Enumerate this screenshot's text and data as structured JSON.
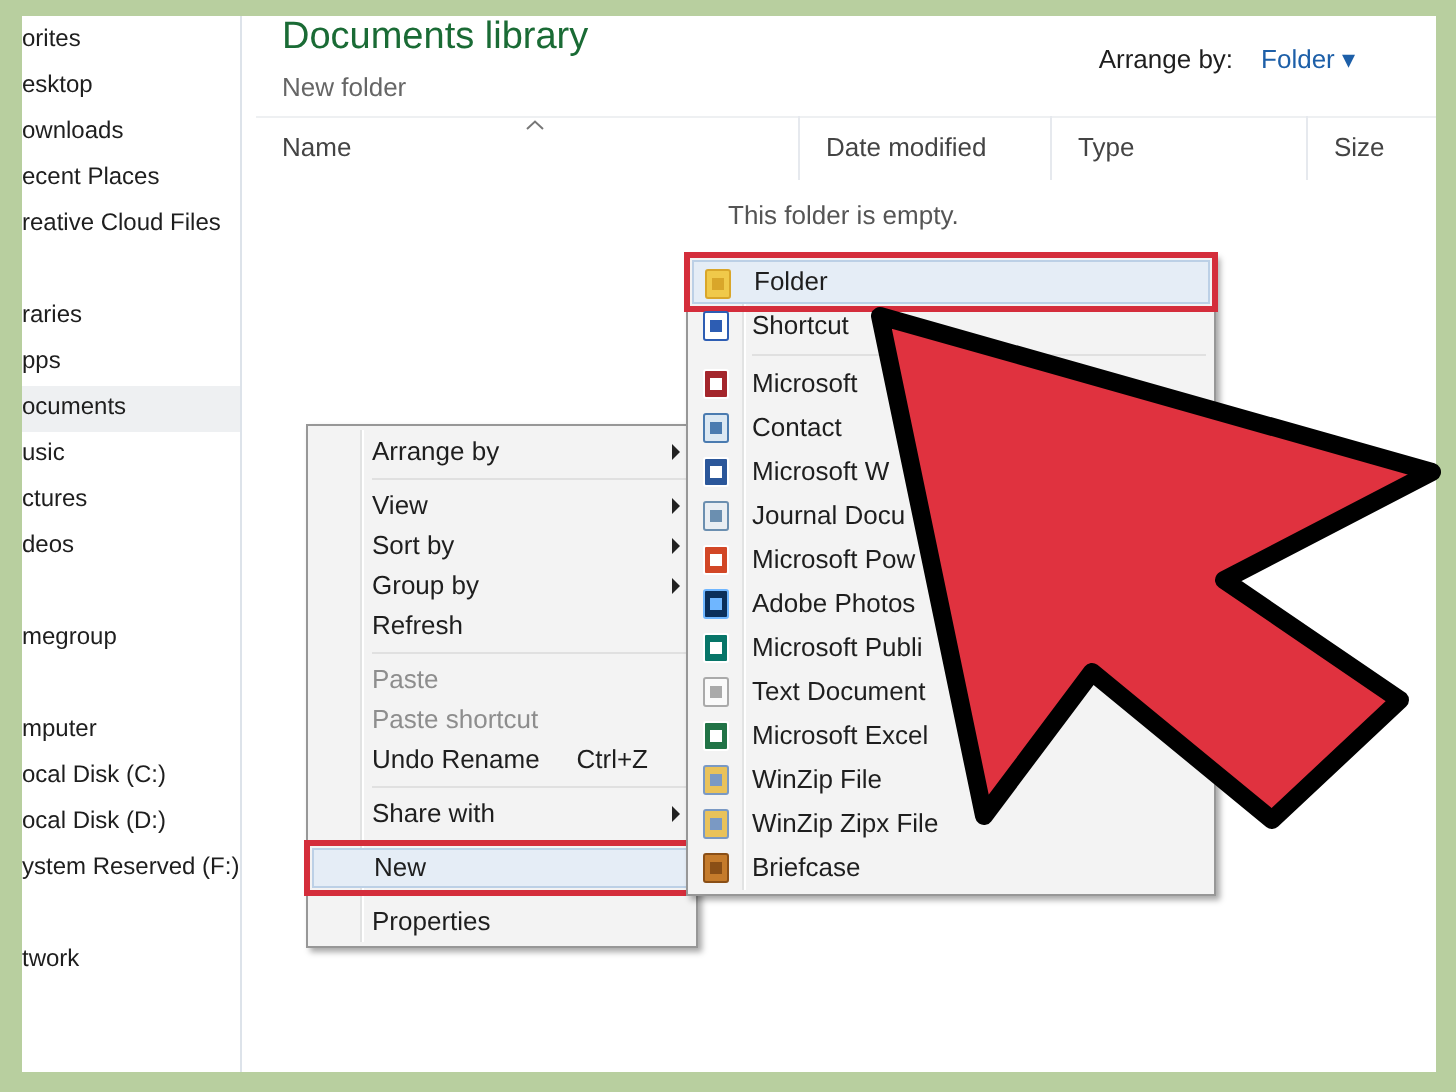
{
  "sidebar": {
    "groups": [
      [
        {
          "label": "orites",
          "selected": false
        },
        {
          "label": "esktop",
          "selected": false
        },
        {
          "label": "ownloads",
          "selected": false
        },
        {
          "label": "ecent Places",
          "selected": false
        },
        {
          "label": "reative Cloud Files",
          "selected": false
        }
      ],
      [
        {
          "label": "raries",
          "selected": false
        },
        {
          "label": "pps",
          "selected": false
        },
        {
          "label": "ocuments",
          "selected": true
        },
        {
          "label": "usic",
          "selected": false
        },
        {
          "label": "ctures",
          "selected": false
        },
        {
          "label": "deos",
          "selected": false
        }
      ],
      [
        {
          "label": "megroup",
          "selected": false
        }
      ],
      [
        {
          "label": "mputer",
          "selected": false
        },
        {
          "label": "ocal Disk (C:)",
          "selected": false
        },
        {
          "label": "ocal Disk (D:)",
          "selected": false
        },
        {
          "label": "ystem Reserved (F:)",
          "selected": false
        }
      ],
      [
        {
          "label": "twork",
          "selected": false
        }
      ]
    ]
  },
  "header": {
    "title": "Documents library",
    "subtitle": "New folder",
    "arrange_label": "Arrange by:",
    "arrange_value": "Folder",
    "arrange_caret": "▾"
  },
  "columns": [
    {
      "label": "Name",
      "sorted": true
    },
    {
      "label": "Date modified",
      "sorted": false
    },
    {
      "label": "Type",
      "sorted": false
    },
    {
      "label": "Size",
      "sorted": false
    }
  ],
  "empty_message": "This folder is empty.",
  "context_menu": {
    "groups": [
      [
        {
          "label": "Arrange by",
          "submenu": true,
          "disabled": false,
          "highlighted": false
        }
      ],
      [
        {
          "label": "View",
          "submenu": true,
          "disabled": false,
          "highlighted": false
        },
        {
          "label": "Sort by",
          "submenu": true,
          "disabled": false,
          "highlighted": false
        },
        {
          "label": "Group by",
          "submenu": true,
          "disabled": false,
          "highlighted": false
        },
        {
          "label": "Refresh",
          "submenu": false,
          "disabled": false,
          "highlighted": false
        }
      ],
      [
        {
          "label": "Paste",
          "submenu": false,
          "disabled": true,
          "highlighted": false
        },
        {
          "label": "Paste shortcut",
          "submenu": false,
          "disabled": true,
          "highlighted": false
        },
        {
          "label": "Undo Rename",
          "shortcut": "Ctrl+Z",
          "submenu": false,
          "disabled": false,
          "highlighted": false
        }
      ],
      [
        {
          "label": "Share with",
          "submenu": true,
          "disabled": false,
          "highlighted": false
        }
      ],
      [
        {
          "label": "New",
          "submenu": false,
          "disabled": false,
          "highlighted": true
        }
      ],
      [
        {
          "label": "Properties",
          "submenu": false,
          "disabled": false,
          "highlighted": false
        }
      ]
    ]
  },
  "new_submenu": {
    "groups": [
      [
        {
          "label": "Folder",
          "kind": "folder",
          "highlighted": true
        },
        {
          "label": "Shortcut",
          "kind": "shortcut",
          "highlighted": false
        }
      ],
      [
        {
          "label": "Microsoft",
          "kind": "access",
          "highlighted": false
        },
        {
          "label": "Contact",
          "kind": "contact",
          "highlighted": false
        },
        {
          "label": "Microsoft W",
          "kind": "word",
          "highlighted": false
        },
        {
          "label": "Journal Docu",
          "kind": "journal",
          "highlighted": false
        },
        {
          "label": "Microsoft Pow",
          "kind": "powerpoint",
          "highlighted": false
        },
        {
          "label": "Adobe Photos",
          "kind": "photoshop",
          "highlighted": false
        },
        {
          "label": "Microsoft Publi",
          "kind": "publisher",
          "highlighted": false
        },
        {
          "label": "Text Document",
          "kind": "text",
          "highlighted": false
        },
        {
          "label": "Microsoft Excel",
          "kind": "excel",
          "highlighted": false
        },
        {
          "label": "WinZip File",
          "kind": "winzip",
          "highlighted": false
        },
        {
          "label": "WinZip Zipx File",
          "kind": "winzip",
          "highlighted": false
        },
        {
          "label": "Briefcase",
          "kind": "briefcase",
          "highlighted": false
        }
      ]
    ]
  }
}
